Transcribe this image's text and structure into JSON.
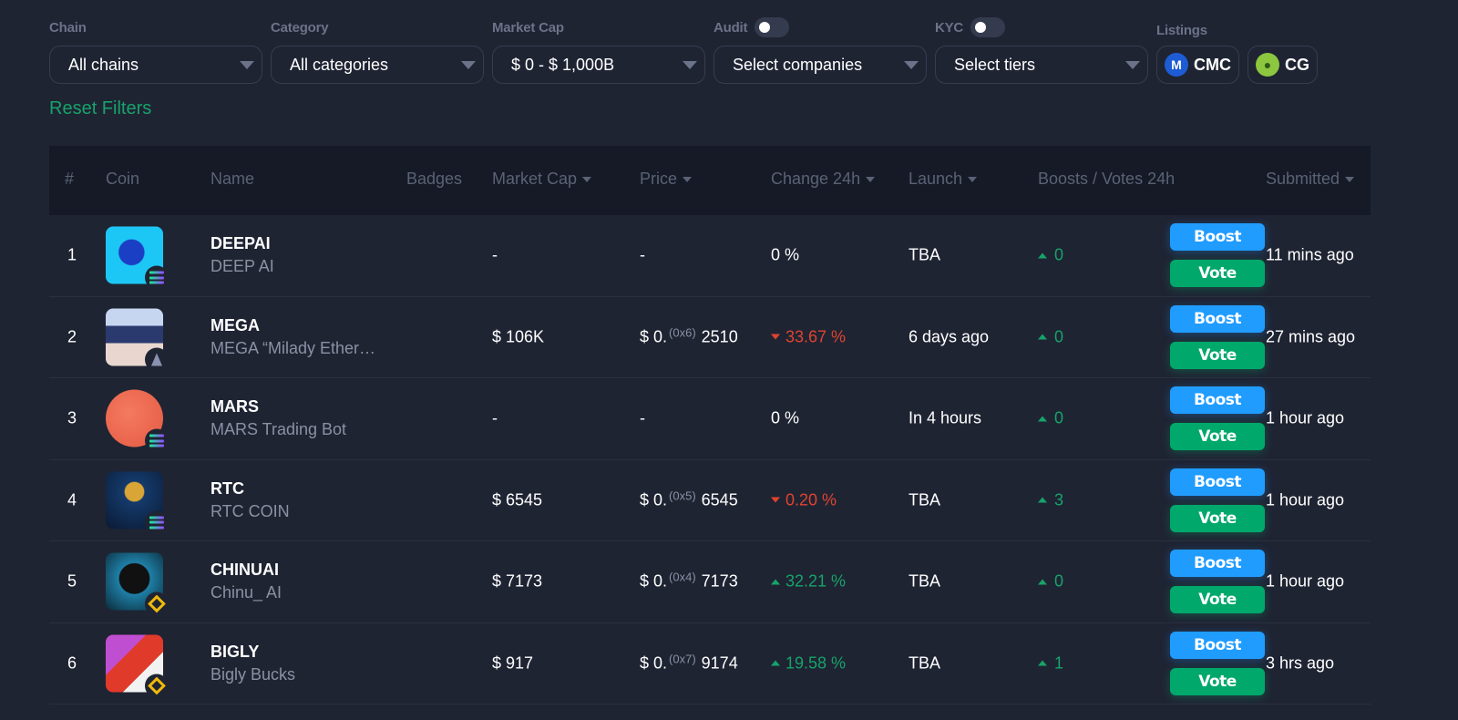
{
  "filters": {
    "chain": {
      "label": "Chain",
      "value": "All chains"
    },
    "category": {
      "label": "Category",
      "value": "All categories"
    },
    "market_cap": {
      "label": "Market Cap",
      "value": "$ 0 - $ 1,000B"
    },
    "audit": {
      "label": "Audit",
      "toggle_on": false,
      "value": "Select companies"
    },
    "kyc": {
      "label": "KYC",
      "toggle_on": false,
      "value": "Select tiers"
    },
    "listings": {
      "label": "Listings",
      "items": [
        {
          "label": "CMC",
          "icon": "coinmarketcap-icon"
        },
        {
          "label": "CG",
          "icon": "coingecko-icon"
        }
      ]
    },
    "reset_label": "Reset Filters"
  },
  "table": {
    "headers": {
      "rank": "#",
      "coin": "Coin",
      "name": "Name",
      "badges": "Badges",
      "market_cap": "Market Cap",
      "price": "Price",
      "change": "Change 24h",
      "launch": "Launch",
      "boosts_votes": "Boosts / Votes 24h",
      "submitted": "Submitted"
    },
    "boost_label": "Boost",
    "vote_label": "Vote",
    "rows": [
      {
        "rank": "1",
        "symbol": "DEEPAI",
        "name": "DEEP AI",
        "chain": "solana",
        "market_cap": "-",
        "price_prefix": "-",
        "price_zeros": "",
        "price_digits": "",
        "change": "0 %",
        "change_dir": "neutral",
        "launch": "TBA",
        "votes": "0",
        "submitted": "11 mins ago"
      },
      {
        "rank": "2",
        "symbol": "MEGA",
        "name": "MEGA “Milady Ether…",
        "chain": "ethereum",
        "market_cap": "$ 106K",
        "price_prefix": "$ 0.",
        "price_zeros": "(0x6)",
        "price_digits": "2510",
        "change": "33.67 %",
        "change_dir": "down",
        "launch": "6 days ago",
        "votes": "0",
        "submitted": "27 mins ago"
      },
      {
        "rank": "3",
        "symbol": "MARS",
        "name": "MARS Trading Bot",
        "chain": "solana",
        "market_cap": "-",
        "price_prefix": "-",
        "price_zeros": "",
        "price_digits": "",
        "change": "0 %",
        "change_dir": "neutral",
        "launch": "In 4 hours",
        "votes": "0",
        "submitted": "1 hour ago"
      },
      {
        "rank": "4",
        "symbol": "RTC",
        "name": "RTC COIN",
        "chain": "solana",
        "market_cap": "$ 6545",
        "price_prefix": "$ 0.",
        "price_zeros": "(0x5)",
        "price_digits": "6545",
        "change": "0.20 %",
        "change_dir": "down",
        "launch": "TBA",
        "votes": "3",
        "submitted": "1 hour ago"
      },
      {
        "rank": "5",
        "symbol": "CHINUAI",
        "name": "Chinu_ AI",
        "chain": "bnb",
        "market_cap": "$ 7173",
        "price_prefix": "$ 0.",
        "price_zeros": "(0x4)",
        "price_digits": "7173",
        "change": "32.21 %",
        "change_dir": "up",
        "launch": "TBA",
        "votes": "0",
        "submitted": "1 hour ago"
      },
      {
        "rank": "6",
        "symbol": "BIGLY",
        "name": "Bigly Bucks",
        "chain": "bnb",
        "market_cap": "$ 917",
        "price_prefix": "$ 0.",
        "price_zeros": "(0x7)",
        "price_digits": "9174",
        "change": "19.58 %",
        "change_dir": "up",
        "launch": "TBA",
        "votes": "1",
        "submitted": "3 hrs ago"
      }
    ]
  },
  "colors": {
    "background": "#1f2433",
    "header_background": "#151a26",
    "positive": "#16a36a",
    "negative": "#e0432f",
    "boost": "#209cff",
    "vote": "#00a86b"
  }
}
